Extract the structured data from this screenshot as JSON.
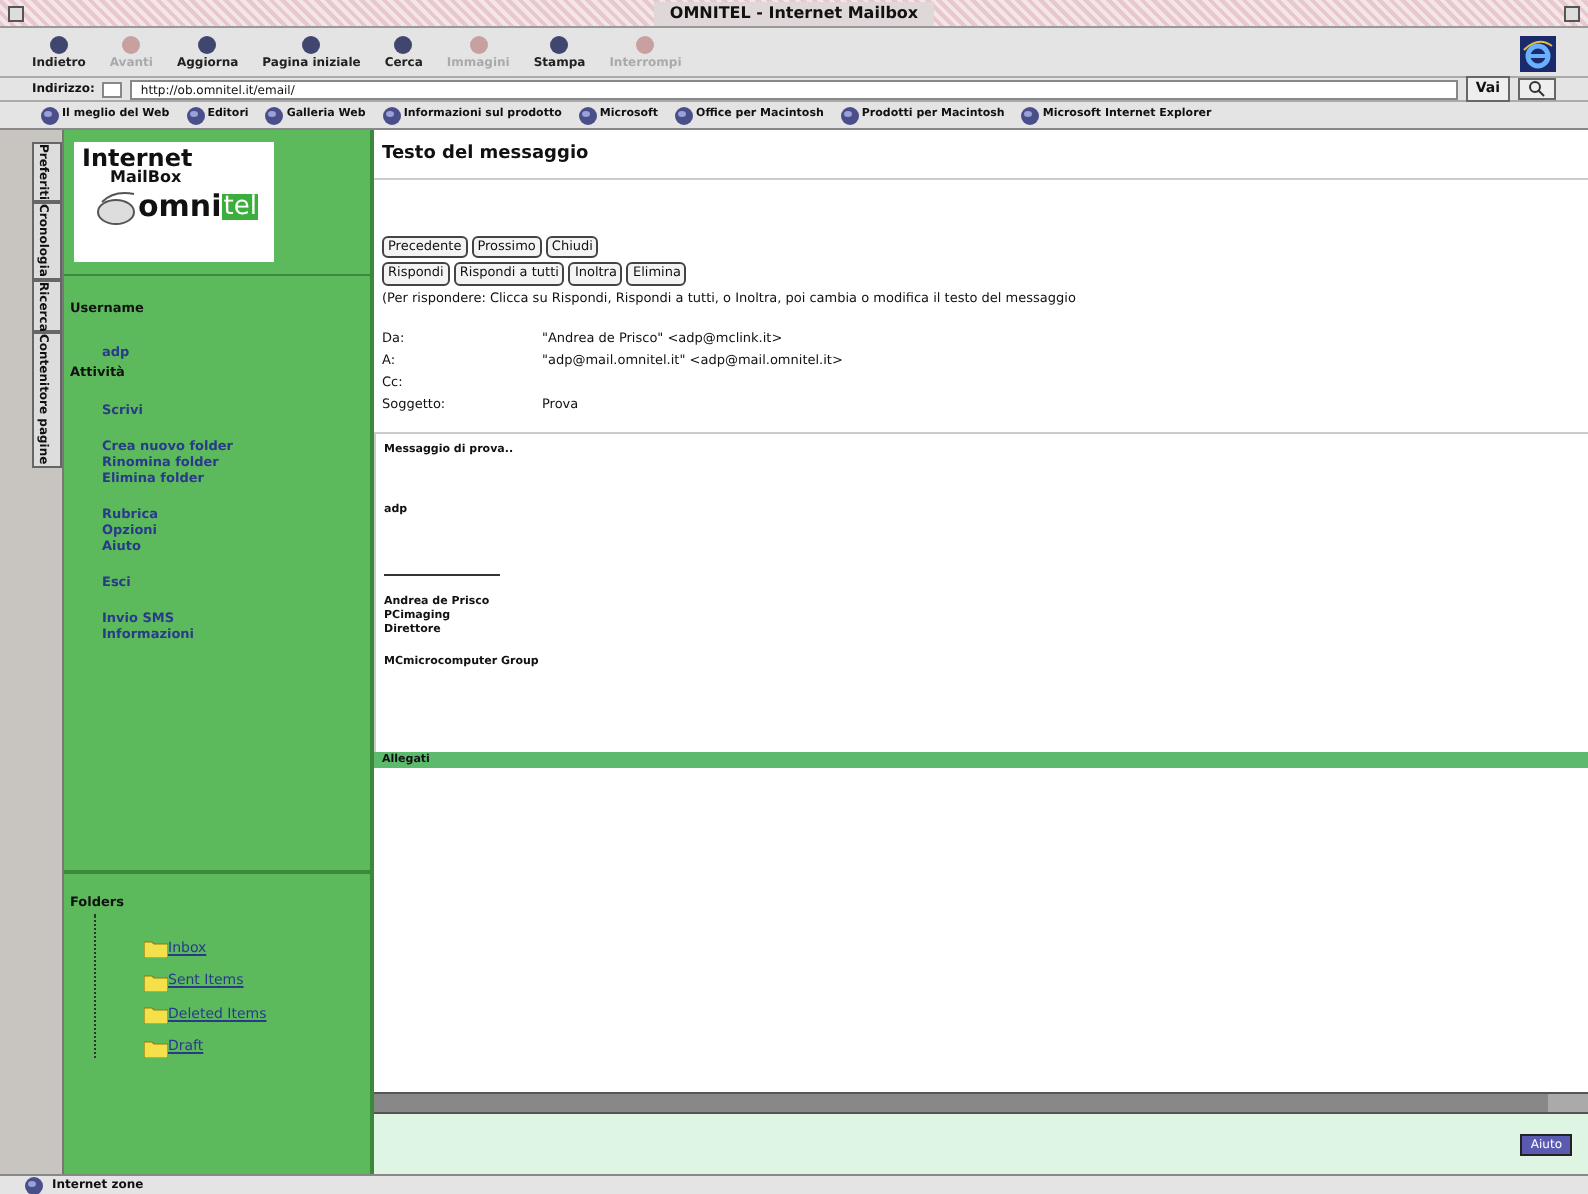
{
  "window": {
    "title": "OMNITEL - Internet Mailbox"
  },
  "toolbar": [
    {
      "label": "Indietro",
      "disabled": false
    },
    {
      "label": "Avanti",
      "disabled": true
    },
    {
      "label": "Aggiorna",
      "disabled": false
    },
    {
      "label": "Pagina iniziale",
      "disabled": false
    },
    {
      "label": "Cerca",
      "disabled": false
    },
    {
      "label": "Immagini",
      "disabled": true
    },
    {
      "label": "Stampa",
      "disabled": false
    },
    {
      "label": "Interrompi",
      "disabled": true
    }
  ],
  "address": {
    "label": "Indirizzo:",
    "value": "http://ob.omnitel.it/email/",
    "go": "Vai"
  },
  "favorites": [
    "Il meglio del Web",
    "Editori",
    "Galleria Web",
    "Informazioni sul prodotto",
    "Microsoft",
    "Office per Macintosh",
    "Prodotti per Macintosh",
    "Microsoft Internet Explorer"
  ],
  "side_tabs": [
    "Preferiti",
    "Cronologia",
    "Ricerca",
    "Contenitore pagine"
  ],
  "logo": {
    "line1": "Internet",
    "line2": "MailBox",
    "brand_a": "omni",
    "brand_b": "tel"
  },
  "sidebar": {
    "username_label": "Username",
    "username": "adp",
    "activity_label": "Attività",
    "groups": [
      [
        "Scrivi"
      ],
      [
        "Crea nuovo folder",
        "Rinomina folder",
        "Elimina folder"
      ],
      [
        "Rubrica",
        "Opzioni",
        "Aiuto"
      ],
      [
        "Esci"
      ],
      [
        "Invio SMS",
        "Informazioni"
      ]
    ]
  },
  "folders": {
    "title": "Folders",
    "items": [
      "Inbox",
      "Sent Items",
      "Deleted Items",
      "Draft"
    ]
  },
  "message": {
    "title": "Testo del messaggio",
    "nav_buttons": [
      "Precedente",
      "Prossimo",
      "Chiudi"
    ],
    "action_buttons": [
      "Rispondi",
      "Rispondi a tutti",
      "Inoltra",
      "Elimina"
    ],
    "hint": "(Per rispondere: Clicca su Rispondi, Rispondi a tutti, o Inoltra, poi cambia o modifica il testo del messaggio",
    "headers": [
      {
        "label": "Da:",
        "value": "\"Andrea de Prisco\" <adp@mclink.it>"
      },
      {
        "label": "A:",
        "value": "\"adp@mail.omnitel.it\" <adp@mail.omnitel.it>"
      },
      {
        "label": "Cc:"
      },
      {
        "label": "Soggetto:",
        "value": "Prova"
      }
    ],
    "body_top": [
      "Messaggio di prova..",
      "adp"
    ],
    "signature": [
      "Andrea de Prisco",
      "PCimaging",
      "Direttore"
    ],
    "company": "MCmicrocomputer Group",
    "attachments_label": "Allegati"
  },
  "help_button": "Aiuto",
  "status_bar": "Internet zone"
}
